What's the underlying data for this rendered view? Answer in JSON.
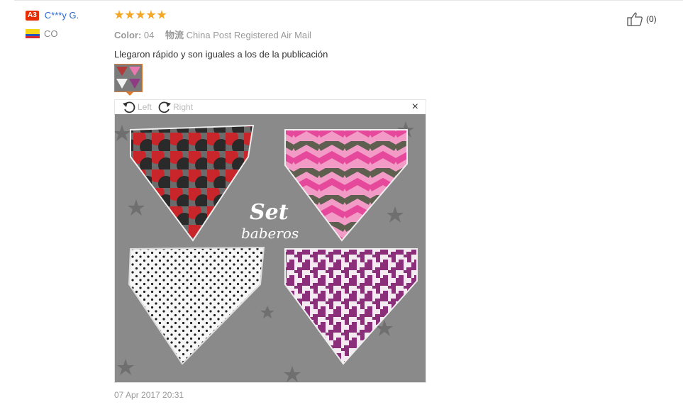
{
  "user": {
    "level": "A3",
    "name": "C***y G.",
    "country": "CO"
  },
  "review": {
    "rating": 5,
    "color_label": "Color:",
    "color_value": "04",
    "shipping_label": "物流",
    "shipping_value": "China Post Registered Air Mail",
    "text": "Llegaron rápido y son iguales a los de la publicación",
    "date": "07 Apr 2017 20:31"
  },
  "viewer": {
    "rotate_left_label": "Left",
    "rotate_right_label": "Right",
    "close_label": "×",
    "photo_caption_line1": "Set",
    "photo_caption_line2": "baberos"
  },
  "helpful": {
    "count": "(0)"
  },
  "colors": {
    "link": "#2a6ad1",
    "star": "#f5a623",
    "badge": "#e62e04",
    "thumb_border": "#e07a2e"
  }
}
